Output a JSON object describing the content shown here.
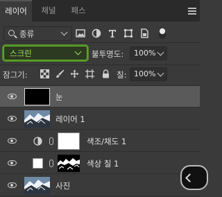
{
  "tabs": [
    {
      "label": "레이어",
      "active": true
    },
    {
      "label": "채널",
      "active": false
    },
    {
      "label": "패스",
      "active": false
    }
  ],
  "filter": {
    "kind_label": "종류",
    "icons": [
      "image-filter-icon",
      "adjustment-filter-icon",
      "type-filter-icon",
      "shape-filter-icon",
      "smart-object-filter-icon",
      "filter-toggle-icon"
    ]
  },
  "blend": {
    "mode": "스크린",
    "opacity_label": "불투명도:",
    "opacity_value": "100%"
  },
  "lock": {
    "label": "잠그기:",
    "icons": [
      "lock-transparent-pixels-icon",
      "lock-image-pixels-icon",
      "lock-position-icon",
      "lock-artboard-icon",
      "lock-all-icon"
    ],
    "fill_label": "칠:",
    "fill_value": "100%"
  },
  "layers": [
    {
      "name": "눈",
      "selected": true,
      "visible": true
    },
    {
      "name": "레이어 1",
      "selected": false,
      "visible": true
    },
    {
      "name": "색조/채도 1",
      "selected": false,
      "visible": true
    },
    {
      "name": "색상 칠 1",
      "selected": false,
      "visible": true
    },
    {
      "name": "사진",
      "selected": false,
      "visible": true
    }
  ],
  "colors": {
    "panel_bg": "#3a3a3a",
    "tabbar_bg": "#2a2a2a",
    "selected_layer_bg": "#5a5a5a",
    "blend_highlight": "#6ab52e",
    "blend_text": "#9be24e"
  }
}
